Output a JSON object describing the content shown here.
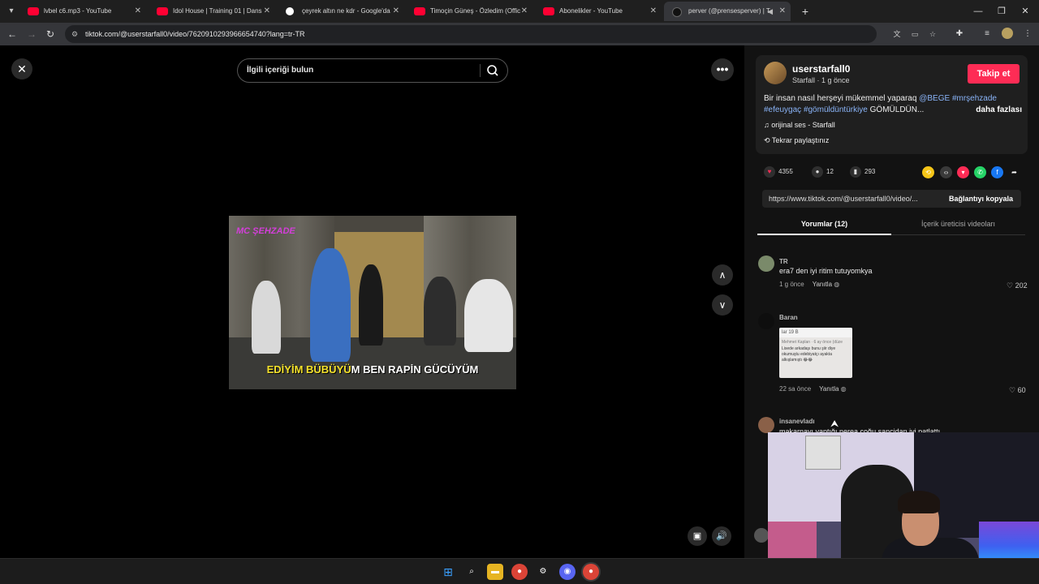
{
  "browser": {
    "tabs": [
      {
        "title": "lvbel c6.mp3 - YouTube",
        "favicon": "youtube-icon"
      },
      {
        "title": "Idol House | Training 01 | Dans",
        "favicon": "youtube-icon"
      },
      {
        "title": "çeyrek altın ne kdr - Google'da",
        "favicon": "google-icon"
      },
      {
        "title": "Timoçin Güneş - Özledim (Offic",
        "favicon": "youtube-icon"
      },
      {
        "title": "Abonelikler - YouTube",
        "favicon": "youtube-icon"
      },
      {
        "title": "perver (@prensesperver) | T",
        "favicon": "tiktok-icon"
      }
    ],
    "url": "tiktok.com/@userstarfall0/video/7620910293966654740?lang=tr-TR"
  },
  "player": {
    "search_placeholder": "İlgili içeriği bulun",
    "watermark": "MC ŞEHZADE",
    "caption_highlight": "EDİYİM BÜBÜYÜ",
    "caption_rest": "M BEN RAPİN GÜCÜYÜM"
  },
  "post": {
    "username": "userstarfall0",
    "display_name": "Starfall",
    "time_ago": "1 g önce",
    "follow_label": "Takip et",
    "desc_plain": "Bir insan nasıl herşeyi mükemmel yaparaq",
    "desc_mention": "@BEGE",
    "desc_tag1": "#mrşehzade",
    "desc_tag2": "#efeuygaç",
    "desc_tag3": "#gömüldüntürkiye",
    "desc_tail": "GÖMÜLDÜN...",
    "more_label": "daha fazlası",
    "sound": "orijinal ses - Starfall",
    "repost": "Tekrar paylaştınız",
    "likes": "4355",
    "comments": "12",
    "saves": "293",
    "link": "https://www.tiktok.com/@userstarfall0/video/...",
    "copy_label": "Bağlantıyı kopyala",
    "tab_comments": "Yorumlar (12)",
    "tab_creator": "İçerik üreticisi videoları",
    "accent": "#fe2c55"
  },
  "comments": [
    {
      "user": "TR",
      "text": "era7 den iyi ritim tutuyomkya",
      "time": "1 g önce",
      "reply": "Yanıtla",
      "likes": "202"
    },
    {
      "user": "Baran",
      "text": "",
      "time": "22 sa önce",
      "reply": "Yanıtla",
      "likes": "60",
      "image_lines": [
        "lar  19 B",
        "Mehmet Kaplan · 6 ay önce (düze",
        "Lisede arkadaşı bunu şiir diye",
        "okumuştu edebiyatçı ayakta",
        "alkışlamıştı 😂😂"
      ]
    },
    {
      "user": "insanevladı",
      "text": "makarnayı yaptığı nerea çoğu sancidan iyi patlattı"
    }
  ]
}
